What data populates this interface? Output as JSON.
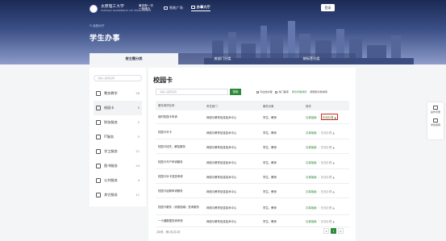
{
  "header": {
    "logo_text": "太原理工大学",
    "logo_sub": "TAIYUAN UNIVERSITY OF TECHNOLOGY",
    "slogan": [
      "最多跑一次",
      "一网通办"
    ],
    "nav": [
      {
        "label": "智能广场",
        "icon": "monitor-icon"
      },
      {
        "label": "办事大厅",
        "icon": "grid-icon"
      }
    ],
    "login_label": "登录",
    "breadcrumb": "↻ 返回大厅",
    "title": "学生办事"
  },
  "category_tabs": [
    "按主题分类",
    "按部门分类",
    "按标签分类"
  ],
  "sidebar": {
    "search_placeholder": "请输入事项名称",
    "items": [
      {
        "label": "教务教学",
        "count": "28",
        "icon": "book-icon"
      },
      {
        "label": "校园卡",
        "count": "8",
        "icon": "card-icon"
      },
      {
        "label": "财务服务",
        "count": "2",
        "icon": "money-icon"
      },
      {
        "label": "IT服务",
        "count": "5",
        "icon": "computer-icon"
      },
      {
        "label": "学工服务",
        "count": "21",
        "icon": "user-icon"
      },
      {
        "label": "图书服务",
        "count": "24",
        "icon": "library-icon"
      },
      {
        "label": "公共服务",
        "count": "4",
        "icon": "globe-icon"
      },
      {
        "label": "其它服务",
        "count": "11",
        "icon": "more-icon"
      }
    ]
  },
  "main": {
    "title": "校园卡",
    "search_placeholder": "请输入事项名称",
    "search_button": "搜索",
    "filters": {
      "online": "可在线办理",
      "hot": "热门事项",
      "link1": "按访问量排序",
      "link2": "按服务对象排序"
    },
    "columns": [
      "服务事项名称",
      "责任部门",
      "服务对象",
      "操作"
    ],
    "rows": [
      {
        "name": "临时校园卡申请",
        "dept": "网络与教育信息技术中心",
        "target": "学生、教师",
        "guide": "办事指南",
        "apply": "在线办理",
        "enabled": true,
        "highlight": true
      },
      {
        "name": "校园卡补卡",
        "dept": "网络与教育信息技术中心",
        "target": "学生、教师",
        "guide": "办事指南",
        "apply": "在线办理",
        "enabled": false,
        "highlight": false
      },
      {
        "name": "校园卡挂失、解挂服务",
        "dept": "网络与教育信息技术中心",
        "target": "学生、教师",
        "guide": "办事指南",
        "apply": "在线办理",
        "enabled": false,
        "highlight": false
      },
      {
        "name": "校园卡开户申请服务",
        "dept": "网络与教育信息技术中心",
        "target": "学生、教师",
        "guide": "办事指南",
        "apply": "在线办理",
        "enabled": false,
        "highlight": false
      },
      {
        "name": "校园卡补卡发放申请",
        "dept": "网络与教育信息技术中心",
        "target": "学生、教师",
        "guide": "办事指南",
        "apply": "在线办理",
        "enabled": false,
        "highlight": false
      },
      {
        "name": "校园卡延期申请服务",
        "dept": "网络与教育信息技术中心",
        "target": "学生、教师",
        "guide": "办事指南",
        "apply": "在线办理",
        "enabled": false,
        "highlight": false
      },
      {
        "name": "校园卡服务（消费指南）查询服务",
        "dept": "网络与教育信息技术中心",
        "target": "学生、教师",
        "guide": "办事指南",
        "apply": "在线办理",
        "enabled": false,
        "highlight": false
      },
      {
        "name": "一卡通数据查询申请",
        "dept": "网络与教育信息技术中心",
        "target": "学生、教师",
        "guide": "办事指南",
        "apply": "在线办理",
        "enabled": false,
        "highlight": false
      }
    ],
    "pager_info": "共8条，第1页/共1页",
    "pages": [
      "<",
      "1",
      ">"
    ]
  },
  "float_tools": [
    {
      "label": "操作手册",
      "icon": "print-icon"
    },
    {
      "label": "学校官网",
      "icon": "monitor-icon"
    }
  ],
  "colors": {
    "accent": "#2c8a3a",
    "header": "#2e3f73",
    "highlight": "#e02020"
  }
}
